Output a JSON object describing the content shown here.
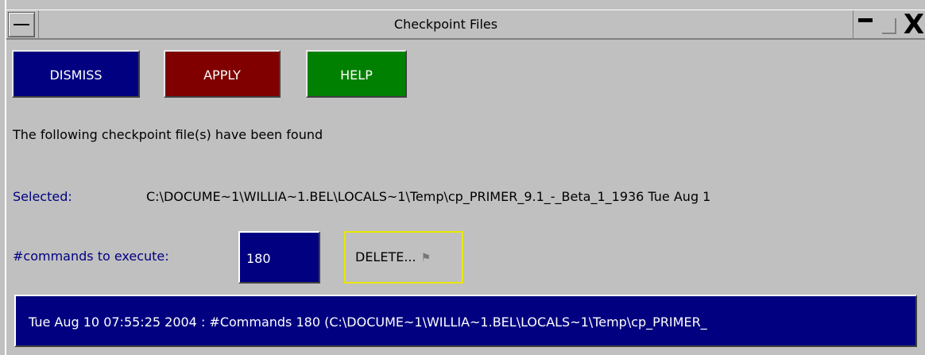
{
  "window": {
    "title": "Checkpoint Files",
    "close_glyph": "X"
  },
  "buttons": {
    "dismiss": "DISMISS",
    "apply": "APPLY",
    "help": "HELP"
  },
  "message": "The following checkpoint file(s) have been found",
  "selected": {
    "label": "Selected:",
    "value": "C:\\DOCUME~1\\WILLIA~1.BEL\\LOCALS~1\\Temp\\cp_PRIMER_9.1_-_Beta_1_1936 Tue Aug 1"
  },
  "commands": {
    "label": "#commands to execute:",
    "value": "180"
  },
  "delete": {
    "label": "DELETE...",
    "icon": "flag-icon"
  },
  "list": {
    "items": [
      "Tue Aug 10 07:55:25 2004 : #Commands 180  (C:\\DOCUME~1\\WILLIA~1.BEL\\LOCALS~1\\Temp\\cp_PRIMER_"
    ]
  },
  "colors": {
    "dismiss": "#000080",
    "apply": "#800000",
    "help": "#008000",
    "background": "#c0c0c0",
    "highlight": "#000080",
    "delete_border": "#e8e800"
  }
}
